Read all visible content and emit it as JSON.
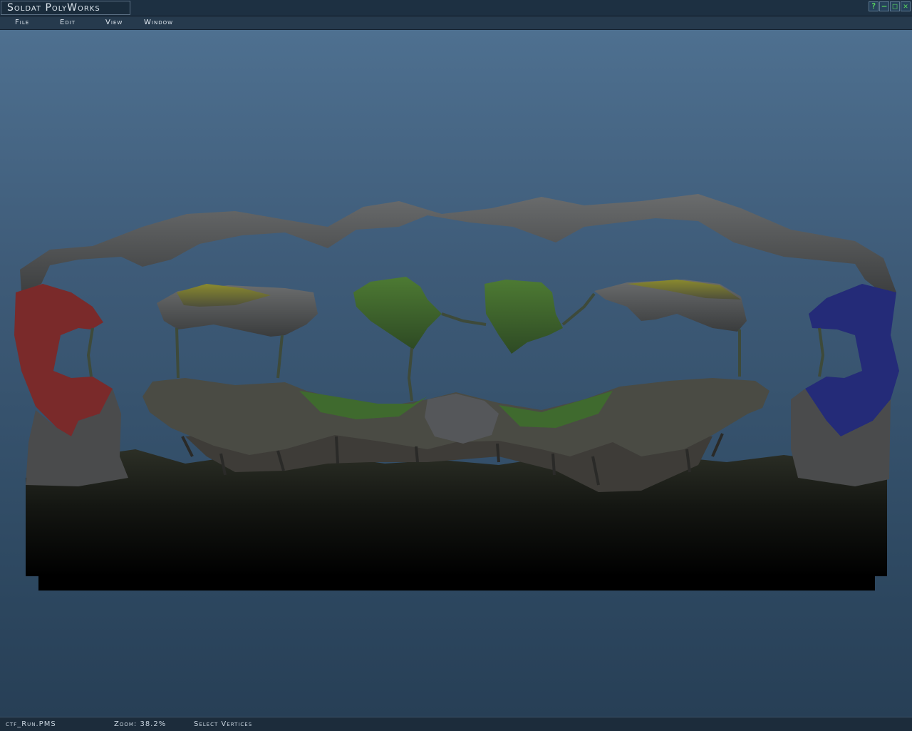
{
  "window": {
    "title": "Soldat PolyWorks",
    "buttons": {
      "help": "?",
      "minimize": "–",
      "maximize": "□",
      "close": "✕"
    }
  },
  "menu": {
    "items": [
      "File",
      "Edit",
      "View",
      "Window"
    ]
  },
  "statusbar": {
    "filename": "ctf_Run.PMS",
    "zoom": "Zoom: 38.2%",
    "tool": "Select Vertices"
  },
  "colors": {
    "accent_green": "#58d35d",
    "red_base": "#8a2c2c",
    "blue_base": "#2c2f8a"
  }
}
